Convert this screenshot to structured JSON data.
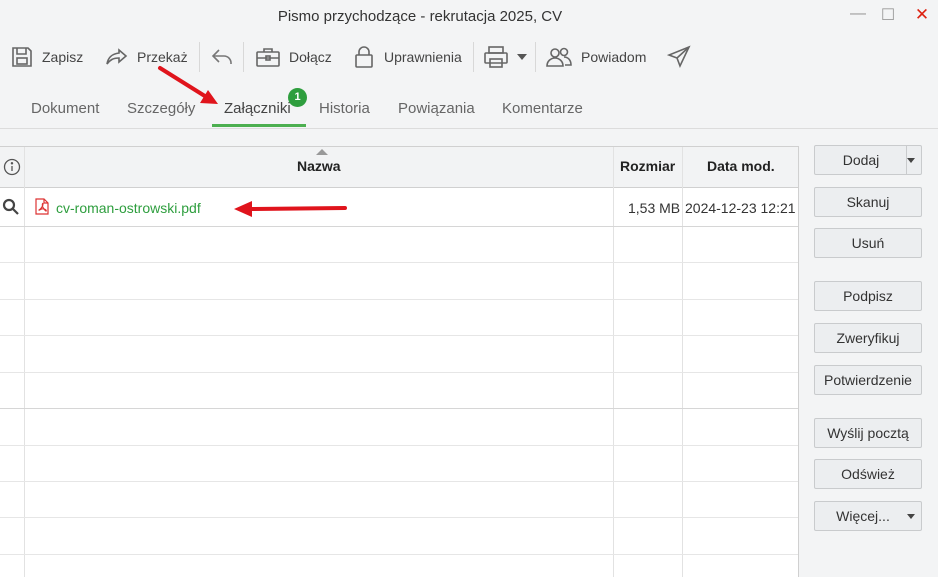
{
  "window": {
    "title": "Pismo przychodzące - rekrutacja 2025, CV"
  },
  "toolbar": {
    "save_label": "Zapisz",
    "forward_label": "Przekaż",
    "attach_label": "Dołącz",
    "permissions_label": "Uprawnienia",
    "notify_label": "Powiadom"
  },
  "tabs": [
    {
      "label": "Dokument"
    },
    {
      "label": "Szczegóły"
    },
    {
      "label": "Załączniki",
      "badge": "1",
      "active": true
    },
    {
      "label": "Historia"
    },
    {
      "label": "Powiązania"
    },
    {
      "label": "Komentarze"
    }
  ],
  "grid": {
    "columns": {
      "info": "i",
      "name": "Nazwa",
      "size": "Rozmiar",
      "date": "Data mod."
    },
    "rows": [
      {
        "name": "cv-roman-ostrowski.pdf",
        "size": "1,53 MB",
        "date": "2024-12-23 12:21"
      }
    ]
  },
  "side_buttons": {
    "add": "Dodaj",
    "scan": "Skanuj",
    "remove": "Usuń",
    "sign": "Podpisz",
    "verify": "Zweryfikuj",
    "confirm": "Potwierdzenie",
    "send_mail": "Wyślij pocztą",
    "refresh": "Odśwież",
    "more": "Więcej..."
  },
  "colors": {
    "accent": "#4caf50",
    "badge": "#2e9e3e",
    "file_link": "#2e9e3e",
    "annotation_arrow": "#e0141c"
  },
  "icons": [
    "save-icon",
    "forward-icon",
    "reply-icon",
    "briefcase-icon",
    "lock-icon",
    "printer-icon",
    "users-icon",
    "send-icon",
    "info-icon",
    "search-icon",
    "pdf-icon"
  ]
}
